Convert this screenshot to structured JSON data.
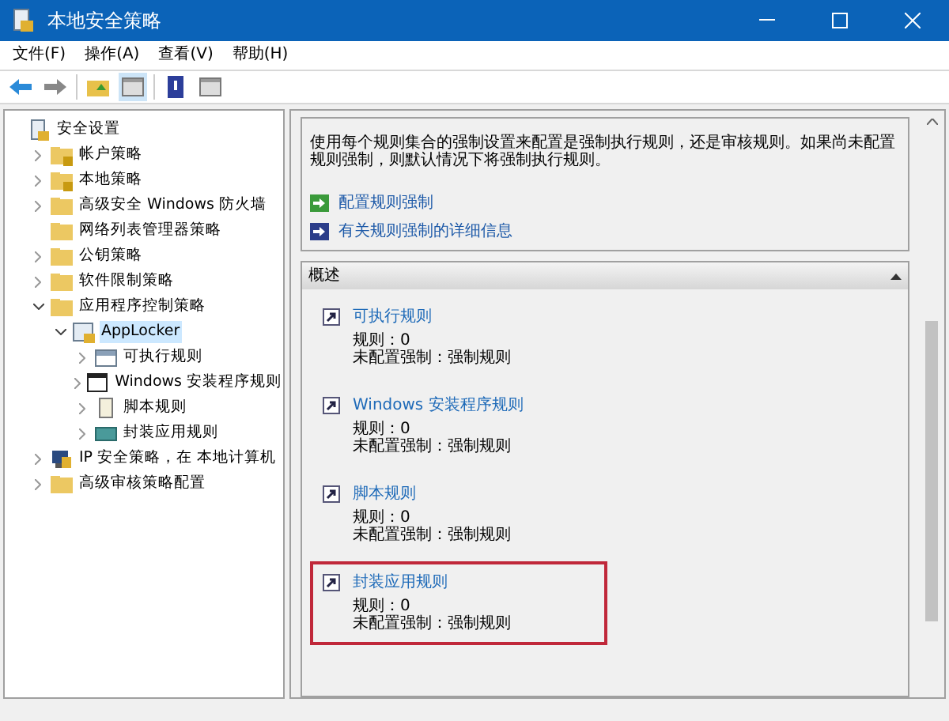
{
  "window": {
    "title": "本地安全策略"
  },
  "menu": [
    {
      "label": "文件(F)"
    },
    {
      "label": "操作(A)"
    },
    {
      "label": "查看(V)"
    },
    {
      "label": "帮助(H)"
    }
  ],
  "tree": [
    {
      "label": "安全设置",
      "kind": "root",
      "selected": false,
      "children": [
        {
          "label": "帐户策略",
          "kind": "lock-folder",
          "expandable": true,
          "expanded": false,
          "selected": false
        },
        {
          "label": "本地策略",
          "kind": "lock-folder",
          "expandable": true,
          "expanded": false,
          "selected": false
        },
        {
          "label": "高级安全 Windows 防火墙",
          "kind": "folder",
          "expandable": true,
          "expanded": false,
          "selected": false
        },
        {
          "label": "网络列表管理器策略",
          "kind": "folder",
          "expandable": false,
          "selected": false
        },
        {
          "label": "公钥策略",
          "kind": "folder",
          "expandable": true,
          "expanded": false,
          "selected": false
        },
        {
          "label": "软件限制策略",
          "kind": "folder",
          "expandable": true,
          "expanded": false,
          "selected": false
        },
        {
          "label": "应用程序控制策略",
          "kind": "folder",
          "expandable": true,
          "expanded": true,
          "selected": false,
          "children": [
            {
              "label": "AppLocker",
              "kind": "applocker",
              "expandable": true,
              "expanded": true,
              "selected": true,
              "children": [
                {
                  "label": "可执行规则",
                  "kind": "table",
                  "expandable": true,
                  "expanded": false,
                  "selected": false
                },
                {
                  "label": "Windows 安装程序规则",
                  "kind": "window",
                  "expandable": true,
                  "expanded": false,
                  "selected": false
                },
                {
                  "label": "脚本规则",
                  "kind": "script",
                  "expandable": true,
                  "expanded": false,
                  "selected": false
                },
                {
                  "label": "封装应用规则",
                  "kind": "package",
                  "expandable": true,
                  "expanded": false,
                  "selected": false
                }
              ]
            }
          ]
        },
        {
          "label": "IP 安全策略，在 本地计算机",
          "kind": "computer",
          "expandable": true,
          "expanded": false,
          "selected": false
        },
        {
          "label": "高级审核策略配置",
          "kind": "folder",
          "expandable": true,
          "expanded": false,
          "selected": false
        }
      ]
    }
  ],
  "description": "使用每个规则集合的强制设置来配置是强制执行规则，还是审核规则。如果尚未配置规则强制，则默认情况下将强制执行规则。",
  "links": [
    {
      "label": "配置规则强制",
      "kind": "action"
    },
    {
      "label": "有关规则强制的详细信息",
      "kind": "info"
    }
  ],
  "overview": {
    "title": "概述",
    "expanded": true,
    "rules": [
      {
        "title": "可执行规则",
        "count": "规则：0",
        "enforcement": "未配置强制：强制规则",
        "highlighted": false
      },
      {
        "title": "Windows 安装程序规则",
        "count": "规则：0",
        "enforcement": "未配置强制：强制规则",
        "highlighted": false
      },
      {
        "title": "脚本规则",
        "count": "规则：0",
        "enforcement": "未配置强制：强制规则",
        "highlighted": false
      },
      {
        "title": "封装应用规则",
        "count": "规则：0",
        "enforcement": "未配置强制：强制规则",
        "highlighted": true
      }
    ]
  }
}
